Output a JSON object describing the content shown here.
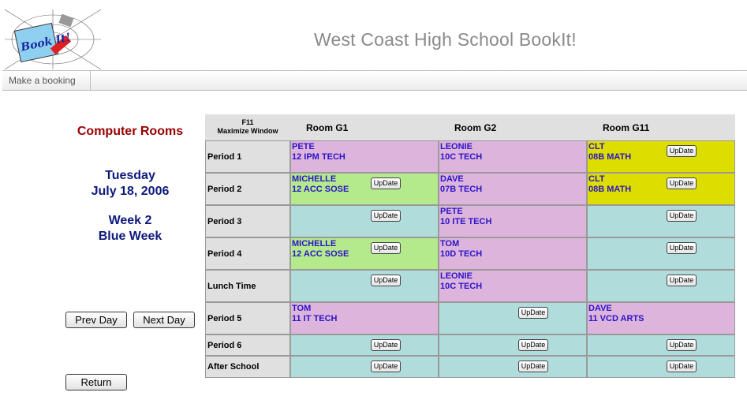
{
  "app": {
    "title": "West Coast High School BookIt!"
  },
  "logo": {
    "text": "Book It!"
  },
  "menu": {
    "make_booking": "Make a booking"
  },
  "side": {
    "title": "Computer Rooms",
    "day": "Tuesday",
    "date": "July 18, 2006",
    "week": "Week 2",
    "week_color": "Blue Week",
    "prev": "Prev Day",
    "next": "Next Day",
    "return": "Return"
  },
  "grid": {
    "f11": "F11",
    "maximize": "Maximize Window",
    "update_label": "UpDate",
    "rooms": [
      "Room G1",
      "Room G2",
      "Room G11"
    ],
    "periods": [
      "Period 1",
      "Period 2",
      "Period 3",
      "Period 4",
      "Lunch Time",
      "Period 5",
      "Period 6",
      "After School"
    ],
    "bookings": {
      "p1": [
        {
          "who": "PETE",
          "what": "12 IPM TECH"
        },
        {
          "who": "LEONIE",
          "what": "10C TECH"
        },
        {
          "who": "CLT",
          "what": "08B MATH"
        }
      ],
      "p2": [
        {
          "who": "MICHELLE",
          "what": "12 ACC SOSE"
        },
        {
          "who": "DAVE",
          "what": "07B TECH"
        },
        {
          "who": "CLT",
          "what": "08B MATH"
        }
      ],
      "p3": [
        null,
        {
          "who": "PETE",
          "what": "10 ITE TECH"
        },
        null
      ],
      "p4": [
        {
          "who": "MICHELLE",
          "what": "12 ACC SOSE"
        },
        {
          "who": "TOM",
          "what": "10D TECH"
        },
        null
      ],
      "lunch": [
        null,
        {
          "who": "LEONIE",
          "what": "10C TECH"
        },
        null
      ],
      "p5": [
        {
          "who": "TOM",
          "what": "11 IT TECH"
        },
        null,
        {
          "who": "DAVE",
          "what": "11 VCD ARTS"
        }
      ]
    }
  },
  "colors": {
    "pink": "#ddb4dc",
    "green": "#b4e98c",
    "yellow": "#dddd00",
    "cyan": "#b0dcdc",
    "header": "#e0e0e0",
    "title_red": "#990000",
    "text_navy": "#0d1a7a",
    "booking_text": "#2b14c8"
  }
}
